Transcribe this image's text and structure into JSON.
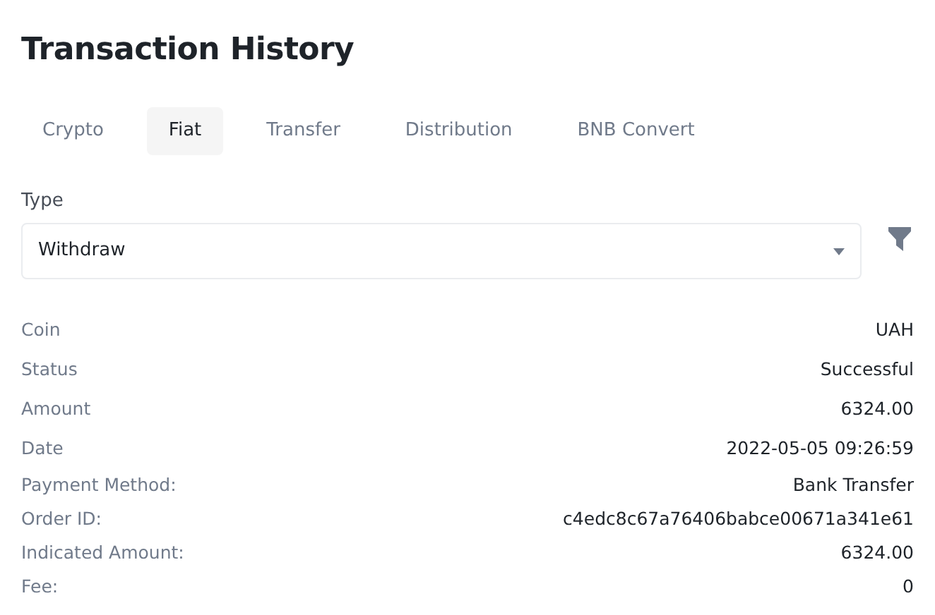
{
  "title": "Transaction History",
  "tabs": [
    {
      "label": "Crypto",
      "selected": false
    },
    {
      "label": "Fiat",
      "selected": true
    },
    {
      "label": "Transfer",
      "selected": false
    },
    {
      "label": "Distribution",
      "selected": false
    },
    {
      "label": "BNB Convert",
      "selected": false
    }
  ],
  "type_filter": {
    "label": "Type",
    "value": "Withdraw"
  },
  "summary": [
    {
      "label": "Coin",
      "value": "UAH"
    },
    {
      "label": "Status",
      "value": "Successful"
    },
    {
      "label": "Amount",
      "value": "6324.00"
    },
    {
      "label": "Date",
      "value": "2022-05-05 09:26:59"
    }
  ],
  "details": [
    {
      "label": "Payment Method:",
      "value": "Bank Transfer"
    },
    {
      "label": "Order ID:",
      "value": "c4edc8c67a76406babce00671a341e61"
    },
    {
      "label": "Indicated Amount:",
      "value": "6324.00"
    },
    {
      "label": "Fee:",
      "value": "0"
    }
  ]
}
